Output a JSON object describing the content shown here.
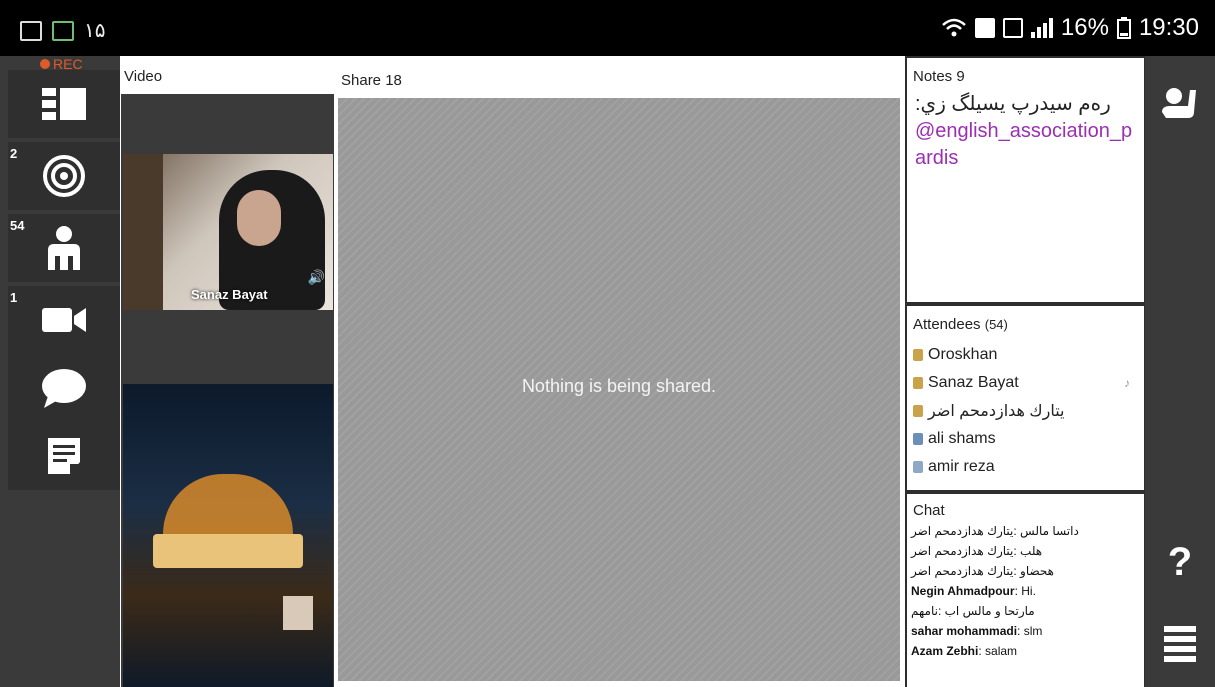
{
  "status_bar": {
    "left_text": "۱۵",
    "battery": "16%",
    "time": "19:30"
  },
  "left_rail": {
    "rec_label": "REC",
    "items": [
      {
        "icon": "layout-icon",
        "badge": ""
      },
      {
        "icon": "target-icon",
        "badge": "2"
      },
      {
        "icon": "user-icon",
        "badge": "54"
      },
      {
        "icon": "camera-icon",
        "badge": "1"
      },
      {
        "icon": "chat-bubble-icon",
        "badge": ""
      },
      {
        "icon": "notes-icon",
        "badge": ""
      }
    ]
  },
  "video_pane": {
    "title": "Video",
    "tile_name": "Sanaz Bayat"
  },
  "share_pane": {
    "title": "Share 18",
    "message": "Nothing is being shared."
  },
  "notes_pane": {
    "title": "Notes 9",
    "text": "رەم سیدرپ یسیلگ زي:",
    "link": "@english_association_pardis"
  },
  "attendees_pane": {
    "title": "Attendees",
    "count": "(54)",
    "rows": [
      {
        "name": "Oroskhan",
        "color": "#c9a24a"
      },
      {
        "name": "Sanaz Bayat",
        "color": "#c9a24a"
      },
      {
        "name": "یتارك هدازدمحم اضر",
        "color": "#c9a24a"
      },
      {
        "name": "ali shams",
        "color": "#6b8fb8"
      },
      {
        "name": "amir reza",
        "color": "#8fa8c8"
      }
    ]
  },
  "chat_pane": {
    "title": "Chat",
    "lines": [
      {
        "sender": "",
        "msg": "داتسا مالس :یتارك هدازدمحم اضر"
      },
      {
        "sender": "",
        "msg": "هلب :یتارك هدازدمحم اضر"
      },
      {
        "sender": "",
        "msg": "هحضاو :یتارك هدازدمحم اضر"
      },
      {
        "sender": "Negin Ahmadpour",
        "msg": "Hi."
      },
      {
        "sender": "",
        "msg": "مارتحا و مالس اب :نامهم"
      },
      {
        "sender": "sahar mohammadi",
        "msg": "slm"
      },
      {
        "sender": "Azam Zebhi",
        "msg": "salam"
      }
    ]
  },
  "far_rail": {
    "help_label": "?"
  }
}
